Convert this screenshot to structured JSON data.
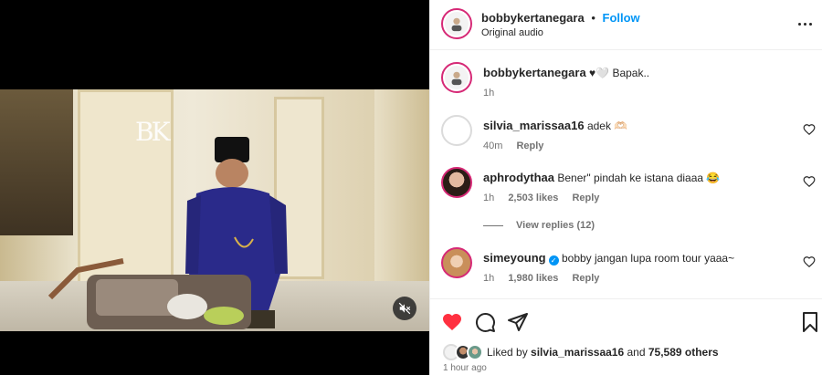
{
  "post": {
    "username": "bobbykertanegara",
    "separator": "•",
    "follow_label": "Follow",
    "audio": "Original audio"
  },
  "video": {
    "watermark": "BK",
    "mute_icon": "speaker-muted-icon"
  },
  "caption": {
    "username": "bobbykertanegara",
    "text": "♥🤍 Bapak..",
    "time": "1h"
  },
  "comments": [
    {
      "username": "silvia_marissaa16",
      "text": "adek 🫶🏻",
      "time": "40m",
      "likes": "",
      "reply_label": "Reply"
    },
    {
      "username": "aphrodythaa",
      "text": "Bener\" pindah ke istana diaaa 😂",
      "time": "1h",
      "likes": "2,503 likes",
      "reply_label": "Reply"
    },
    {
      "username": "simeyoung",
      "text": "bobby jangan lupa room tour yaaa~",
      "time": "1h",
      "likes": "1,980 likes",
      "reply_label": "Reply"
    }
  ],
  "view_replies": "View replies (12)",
  "likes": {
    "prefix": "Liked by",
    "user": "silvia_marissaa16",
    "and": "and",
    "count": "75,589 others"
  },
  "time_ago": "1 hour ago",
  "colors": {
    "link_blue": "#0095f6",
    "like_red": "#ff3040",
    "muted_text": "#737373"
  }
}
